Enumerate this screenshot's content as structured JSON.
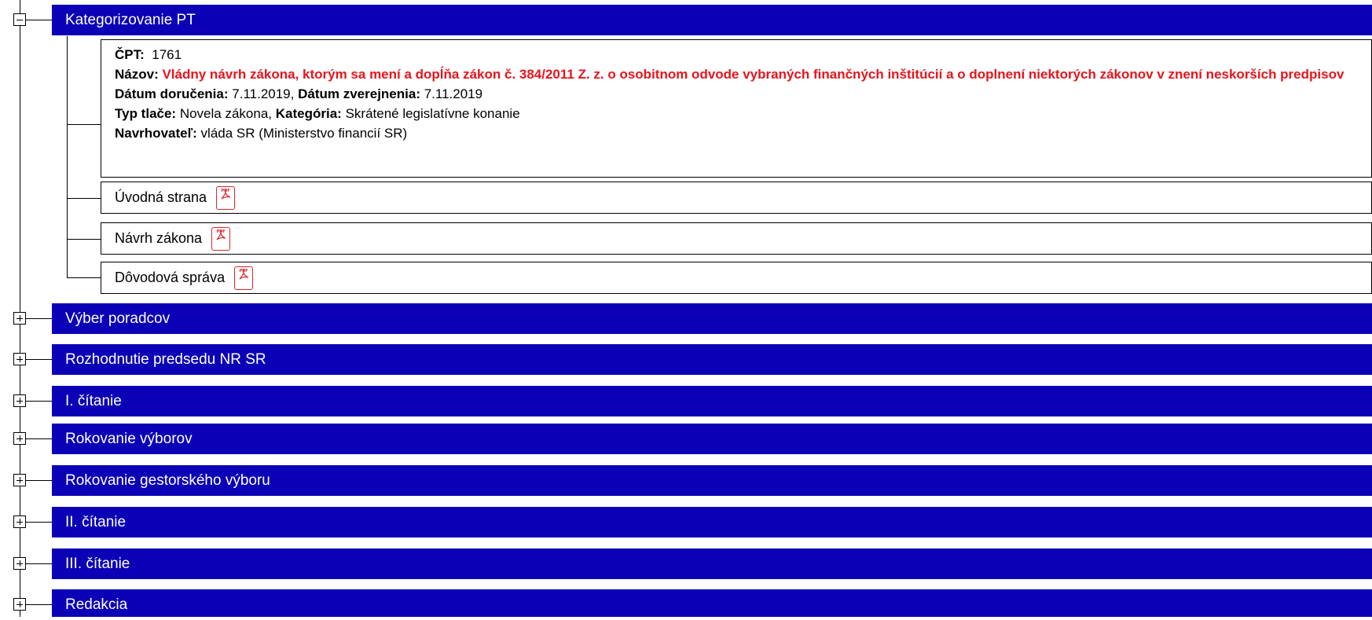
{
  "tree": {
    "expanded_section": {
      "label": "Kategorizovanie PT",
      "details": {
        "cpt_label": "ČPT:",
        "cpt_value": "1761",
        "nazov_label": "Názov:",
        "nazov_value": "Vládny návrh zákona, ktorým sa mení a dopĺňa zákon č. 384/2011 Z. z. o osobitnom odvode vybraných finančných inštitúcií a o doplnení niektorých zákonov v znení neskorších predpisov",
        "datum_dorucenia_label": "Dátum doručenia:",
        "datum_dorucenia_value": "7.11.2019",
        "separator": ", ",
        "datum_zverejnenia_label": "Dátum zverejnenia:",
        "datum_zverejnenia_value": "7.11.2019",
        "typ_tlace_label": "Typ tlače:",
        "typ_tlace_value": "Novela zákona",
        "kategoria_label": "Kategória:",
        "kategoria_value": "Skrátené legislatívne konanie",
        "navrhovatel_label": "Navrhovateľ:",
        "navrhovatel_value": "vláda SR (Ministerstvo financií SR)"
      },
      "documents": [
        {
          "label": "Úvodná strana",
          "icon": "pdf-icon",
          "icon_text": "PDF"
        },
        {
          "label": "Návrh zákona",
          "icon": "pdf-icon",
          "icon_text": "PDF"
        },
        {
          "label": "Dôvodová správa",
          "icon": "pdf-icon",
          "icon_text": "PDF"
        }
      ]
    },
    "collapsed_sections": [
      {
        "label": "Výber poradcov"
      },
      {
        "label": "Rozhodnutie predsedu NR SR"
      },
      {
        "label": "I. čítanie"
      },
      {
        "label": "Rokovanie výborov"
      },
      {
        "label": "Rokovanie gestorského výboru"
      },
      {
        "label": "II. čítanie"
      },
      {
        "label": "III. čítanie"
      },
      {
        "label": "Redakcia"
      }
    ]
  },
  "colors": {
    "section_bar": "#0b00b6",
    "section_text": "#ffffff",
    "title_red": "#e8141c",
    "pdf_red": "#d8262a"
  }
}
